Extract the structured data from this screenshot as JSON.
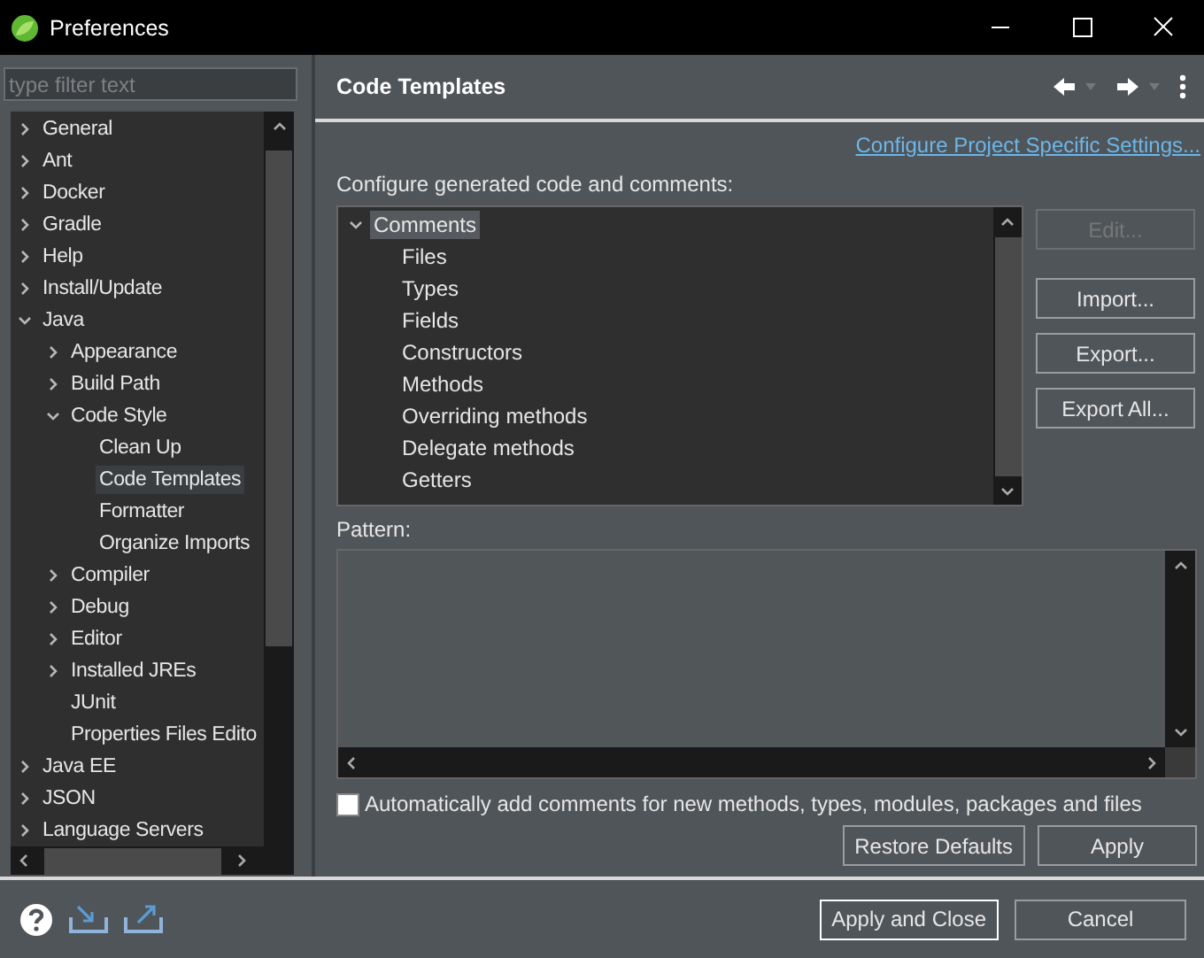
{
  "window": {
    "title": "Preferences"
  },
  "filter": {
    "placeholder": "type filter text"
  },
  "nav_tree": [
    {
      "label": "General",
      "expanded": false,
      "selected": false
    },
    {
      "label": "Ant",
      "expanded": false,
      "selected": false
    },
    {
      "label": "Docker",
      "expanded": false,
      "selected": false
    },
    {
      "label": "Gradle",
      "expanded": false,
      "selected": false
    },
    {
      "label": "Help",
      "expanded": false,
      "selected": false
    },
    {
      "label": "Install/Update",
      "expanded": false,
      "selected": false
    },
    {
      "label": "Java",
      "expanded": true,
      "selected": false,
      "children": [
        {
          "label": "Appearance",
          "expanded": false,
          "selected": false
        },
        {
          "label": "Build Path",
          "expanded": false,
          "selected": false
        },
        {
          "label": "Code Style",
          "expanded": true,
          "selected": false,
          "children": [
            {
              "label": "Clean Up",
              "selected": false
            },
            {
              "label": "Code Templates",
              "selected": true
            },
            {
              "label": "Formatter",
              "selected": false
            },
            {
              "label": "Organize Imports",
              "selected": false
            }
          ]
        },
        {
          "label": "Compiler",
          "expanded": false,
          "selected": false
        },
        {
          "label": "Debug",
          "expanded": false,
          "selected": false
        },
        {
          "label": "Editor",
          "expanded": false,
          "selected": false
        },
        {
          "label": "Installed JREs",
          "expanded": false,
          "selected": false
        },
        {
          "label": "JUnit",
          "selected": false
        },
        {
          "label": "Properties Files Edito",
          "selected": false
        }
      ]
    },
    {
      "label": "Java EE",
      "expanded": false,
      "selected": false
    },
    {
      "label": "JSON",
      "expanded": false,
      "selected": false
    },
    {
      "label": "Language Servers",
      "expanded": false,
      "selected": false
    }
  ],
  "page": {
    "title": "Code Templates",
    "link": "Configure Project Specific Settings...",
    "intro": "Configure generated code and comments:"
  },
  "templates": [
    {
      "label": "Comments",
      "expanded": true,
      "selected": true,
      "children": [
        {
          "label": "Files",
          "selected": false
        },
        {
          "label": "Types",
          "selected": false
        },
        {
          "label": "Fields",
          "selected": false
        },
        {
          "label": "Constructors",
          "selected": false
        },
        {
          "label": "Methods",
          "selected": false
        },
        {
          "label": "Overriding methods",
          "selected": false
        },
        {
          "label": "Delegate methods",
          "selected": false
        },
        {
          "label": "Getters",
          "selected": false
        }
      ]
    }
  ],
  "template_buttons": [
    {
      "label": "Edit...",
      "disabled": true
    },
    {
      "label": "Import...",
      "disabled": false
    },
    {
      "label": "Export...",
      "disabled": false
    },
    {
      "label": "Export All...",
      "disabled": false
    }
  ],
  "pattern": {
    "label": "Pattern:"
  },
  "auto_comments": {
    "label": "Automatically add comments for new methods, types, modules, packages and files",
    "checked": false
  },
  "page_buttons": [
    {
      "label": "Restore Defaults"
    },
    {
      "label": "Apply"
    }
  ],
  "dialog_buttons": [
    {
      "label": "Apply and Close",
      "default": true
    },
    {
      "label": "Cancel",
      "default": false
    }
  ]
}
